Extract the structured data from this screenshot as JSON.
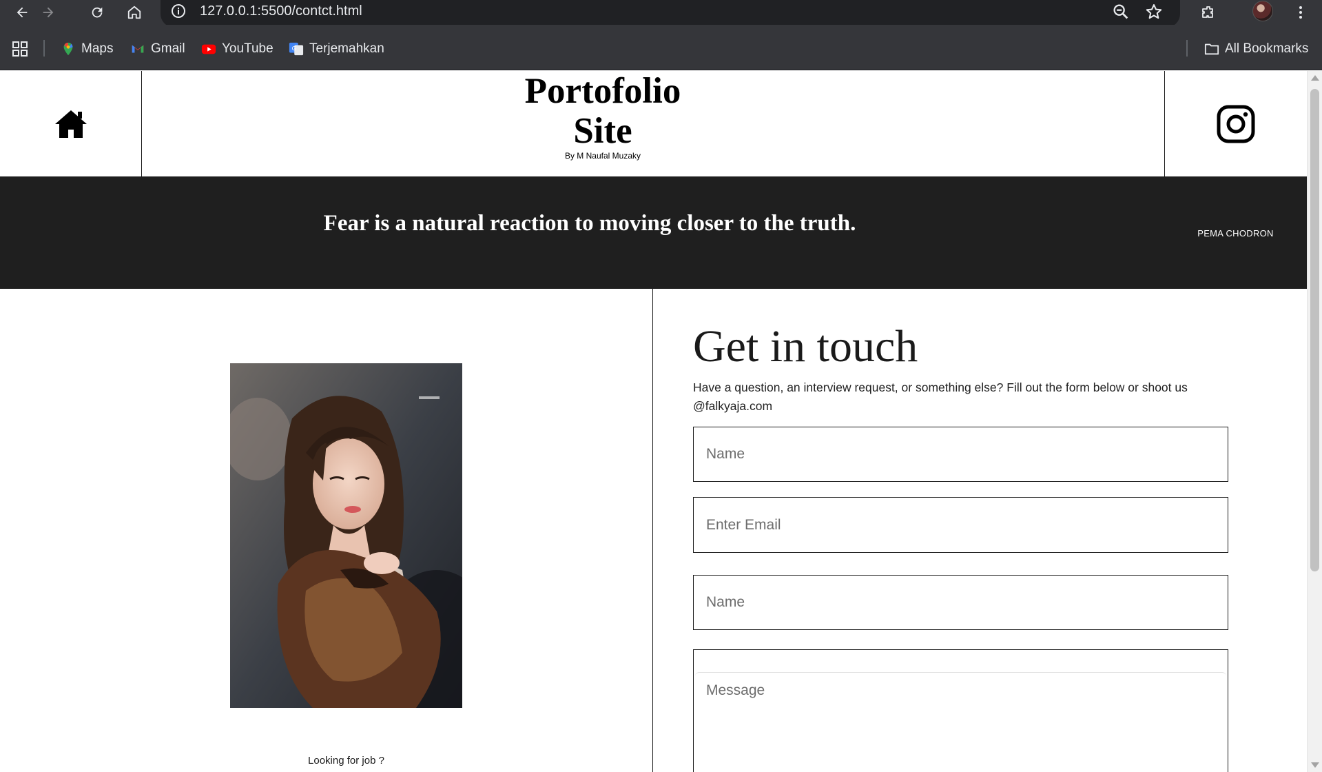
{
  "browser": {
    "url": "127.0.0.1:5500/contct.html",
    "bookmarks": [
      {
        "label": "Maps",
        "icon": "maps-pin-icon"
      },
      {
        "label": "Gmail",
        "icon": "gmail-icon"
      },
      {
        "label": "YouTube",
        "icon": "youtube-icon"
      },
      {
        "label": "Terjemahkan",
        "icon": "translate-icon"
      }
    ],
    "all_bookmarks_label": "All Bookmarks"
  },
  "header": {
    "title_line1": "Portofolio",
    "title_line2": "Site",
    "byline": "By M Naufal Muzaky",
    "left_icon": "home-icon",
    "right_icon": "instagram-icon"
  },
  "quote": {
    "text": "Fear is a natural reaction to moving closer to the truth.",
    "author": "PEMA CHODRON"
  },
  "left": {
    "caption": "Looking for job ?"
  },
  "contact": {
    "title": "Get in touch",
    "description": "Have a question, an interview request, or something else? Fill out the form below or shoot us @falkyaja.com",
    "fields": {
      "name_placeholder": "Name",
      "email_placeholder": "Enter Email",
      "name2_placeholder": "Name",
      "message_placeholder": "Message"
    }
  },
  "colors": {
    "chrome_bg": "#35363a",
    "omnibox_bg": "#202124",
    "quote_band": "#1f1f1f",
    "text_dark": "#1a1a1a"
  }
}
